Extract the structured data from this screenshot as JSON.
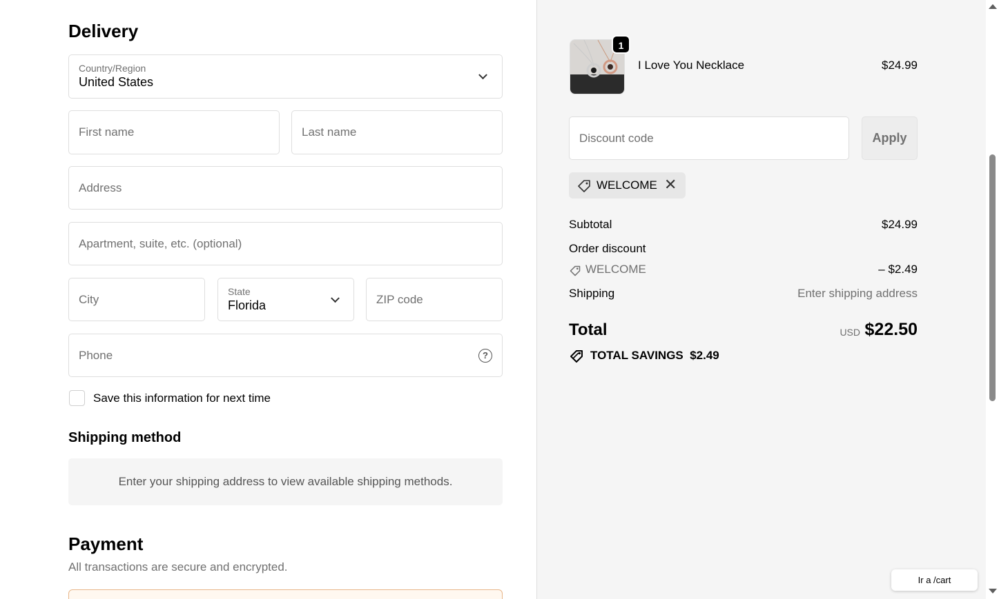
{
  "delivery": {
    "title": "Delivery",
    "country_label": "Country/Region",
    "country_value": "United States",
    "first_name_placeholder": "First name",
    "last_name_placeholder": "Last name",
    "address_placeholder": "Address",
    "apartment_placeholder": "Apartment, suite, etc. (optional)",
    "city_placeholder": "City",
    "state_label": "State",
    "state_value": "Florida",
    "zip_placeholder": "ZIP code",
    "phone_placeholder": "Phone",
    "help_glyph": "?",
    "save_info_label": "Save this information for next time"
  },
  "shipping": {
    "title": "Shipping method",
    "message": "Enter your shipping address to view available shipping methods."
  },
  "payment": {
    "title": "Payment",
    "subtitle": "All transactions are secure and encrypted."
  },
  "cart": {
    "quantity_badge": "1",
    "product_name": "I Love You Necklace",
    "product_price": "$24.99",
    "discount_placeholder": "Discount code",
    "apply_label": "Apply",
    "applied_code": "WELCOME",
    "chip_remove_glyph": "✕",
    "subtotal_label": "Subtotal",
    "subtotal_value": "$24.99",
    "order_discount_label": "Order discount",
    "discount_code_label": "WELCOME",
    "discount_value": "– $2.49",
    "shipping_label": "Shipping",
    "shipping_value": "Enter shipping address",
    "total_label": "Total",
    "total_currency": "USD",
    "total_value": "$22.50",
    "total_savings_label": "TOTAL SAVINGS",
    "total_savings_value": "$2.49"
  },
  "floating_button": {
    "label": "Ir a /cart"
  },
  "icons": {
    "tag": "tag-icon",
    "help": "help-icon",
    "chevron": "chevron-down-icon",
    "close": "close-icon"
  },
  "colors": {
    "panel_bg": "#f5f5f5",
    "border": "#dedede",
    "muted_text": "#707070",
    "badge_bg": "#000000"
  }
}
